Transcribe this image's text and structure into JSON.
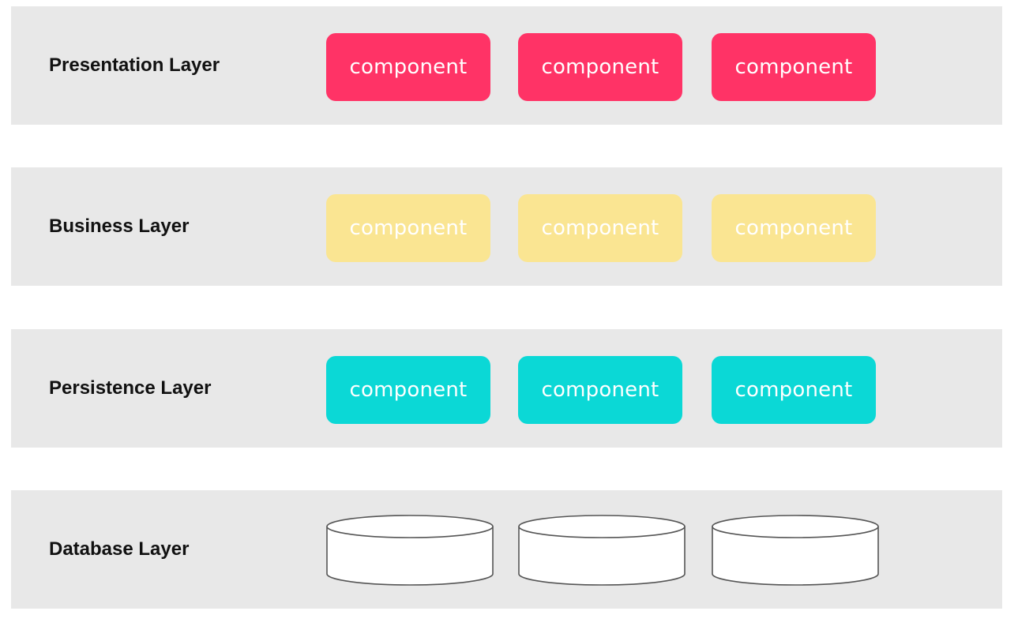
{
  "layers": [
    {
      "label": "Presentation Layer",
      "kind": "components",
      "color": "#ff3366",
      "text_color": "#ffffff",
      "components": [
        "component",
        "component",
        "component"
      ]
    },
    {
      "label": "Business Layer",
      "kind": "components",
      "color": "#fae592",
      "text_color": "#ffffff",
      "components": [
        "component",
        "component",
        "component"
      ]
    },
    {
      "label": "Persistence Layer",
      "kind": "components",
      "color": "#0bd8d6",
      "text_color": "#ffffff",
      "components": [
        "component",
        "component",
        "component"
      ]
    },
    {
      "label": "Database Layer",
      "kind": "databases",
      "color": "#ffffff",
      "databases": 3
    }
  ],
  "colors": {
    "layer_background": "#e8e8e8",
    "database_stroke": "#555555"
  }
}
